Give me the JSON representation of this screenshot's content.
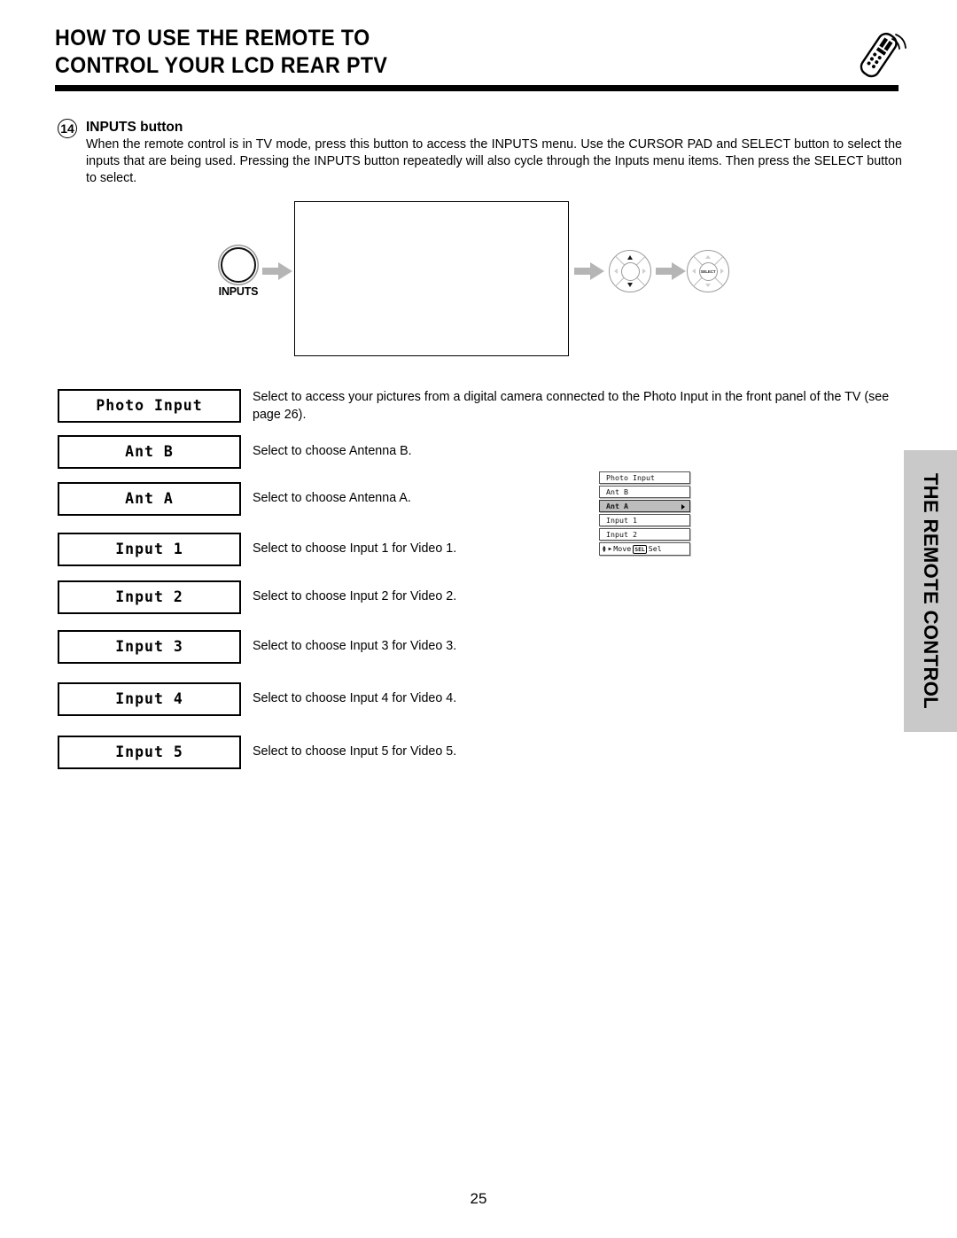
{
  "header": {
    "title_line1": "HOW TO USE THE REMOTE TO",
    "title_line2": "CONTROL YOUR LCD REAR PTV",
    "icon": "remote-control-icon"
  },
  "section": {
    "number": "14",
    "heading": "INPUTS button",
    "body": "When the remote control is in TV mode, press this button to access the INPUTS menu.  Use the CURSOR PAD and SELECT button to select the inputs that are being used.  Pressing the INPUTS button repeatedly will also cycle through the Inputs menu items. Then press the SELECT button to select."
  },
  "diagram": {
    "inputs_button_label": "INPUTS",
    "osd_items": [
      {
        "label": "Photo Input",
        "selected": false
      },
      {
        "label": "Ant B",
        "selected": false
      },
      {
        "label": "Ant A",
        "selected": true
      },
      {
        "label": "Input 1",
        "selected": false
      },
      {
        "label": "Input 2",
        "selected": false
      }
    ],
    "osd_footer": {
      "move_label": "Move",
      "sel_key": "SEL",
      "sel_label": "Sel"
    },
    "cursor_pad_name": "cursor-pad",
    "select_button_label": "SELECT"
  },
  "rows": [
    {
      "button": "Photo Input",
      "description": "Select to access your pictures from a digital camera connected to the Photo Input in the front panel of the TV (see page 26)."
    },
    {
      "button": "Ant B",
      "description": "Select to choose Antenna B."
    },
    {
      "button": "Ant A",
      "description": "Select to choose Antenna A."
    },
    {
      "button": "Input 1",
      "description": "Select to choose Input 1 for Video 1."
    },
    {
      "button": "Input 2",
      "description": "Select to choose Input 2 for Video 2."
    },
    {
      "button": "Input 3",
      "description": "Select to choose Input 3 for Video 3."
    },
    {
      "button": "Input 4",
      "description": "Select to choose Input 4 for Video 4."
    },
    {
      "button": "Input 5",
      "description": "Select to choose Input 5 for Video 5."
    }
  ],
  "side_tab": {
    "label": "THE REMOTE CONTROL",
    "color": "#c9c9c9"
  },
  "footer": {
    "page_number": "25"
  }
}
